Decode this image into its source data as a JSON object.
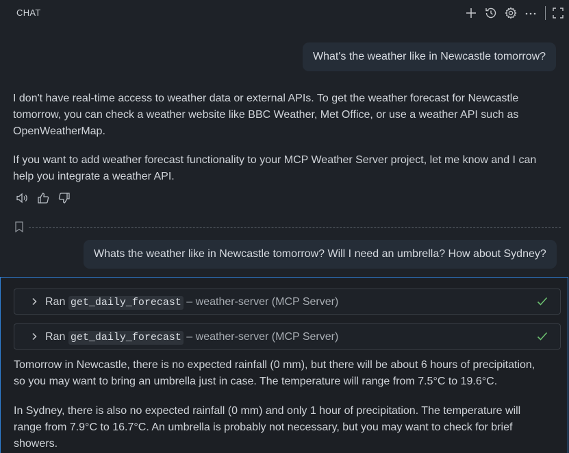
{
  "header": {
    "title": "CHAT"
  },
  "conversation": {
    "user_message_1": "What's the weather like in Newcastle tomorrow?",
    "assistant_reply_1": {
      "para1_line1": "I don't have real-time access to weather data or external APIs. To get the weather forecast for Newcastle",
      "para1_line2": "tomorrow, you can check a weather website like BBC Weather, Met Office, or use a weather API such as",
      "para1_line3": "OpenWeatherMap.",
      "para2_line1": "If you want to add weather forecast functionality to your MCP Weather Server project, let me know and I can",
      "para2_line2": "help you integrate a weather API."
    },
    "user_message_2": "Whats the weather like in Newcastle tomorrow? Will I need an umbrella? How about Sydney?",
    "tool_calls": [
      {
        "prefix": "Ran",
        "tool": "get_daily_forecast",
        "separator": "–",
        "server": "weather-server (MCP Server)",
        "status": "done"
      },
      {
        "prefix": "Ran",
        "tool": "get_daily_forecast",
        "separator": "–",
        "server": "weather-server (MCP Server)",
        "status": "done"
      }
    ],
    "assistant_reply_2": {
      "para1_line1": "Tomorrow in Newcastle, there is no expected rainfall (0 mm), but there will be about 6 hours of precipitation,",
      "para1_line2": "so you may want to bring an umbrella just in case. The temperature will range from 7.5°C to 19.6°C.",
      "para2_line1": "In Sydney, there is also no expected rainfall (0 mm) and only 1 hour of precipitation. The temperature will",
      "para2_line2": "range from 7.9°C to 16.7°C. An umbrella is probably not necessary, but you may want to check for brief",
      "para2_line3": "showers."
    }
  },
  "icons": {
    "header": [
      "plus-icon",
      "history-icon",
      "gear-icon",
      "more-icon",
      "maximize-icon"
    ],
    "feedback": [
      "speaker-icon",
      "thumbs-up-icon",
      "thumbs-down-icon"
    ],
    "checkpoint": "bookmark-icon",
    "tool_status": "check-icon",
    "tool_expand": "chevron-right-icon"
  },
  "colors": {
    "background": "#1e2228",
    "user_bubble": "#252d37",
    "focus_border": "#2f7fd4",
    "success_check": "#6cc070"
  }
}
